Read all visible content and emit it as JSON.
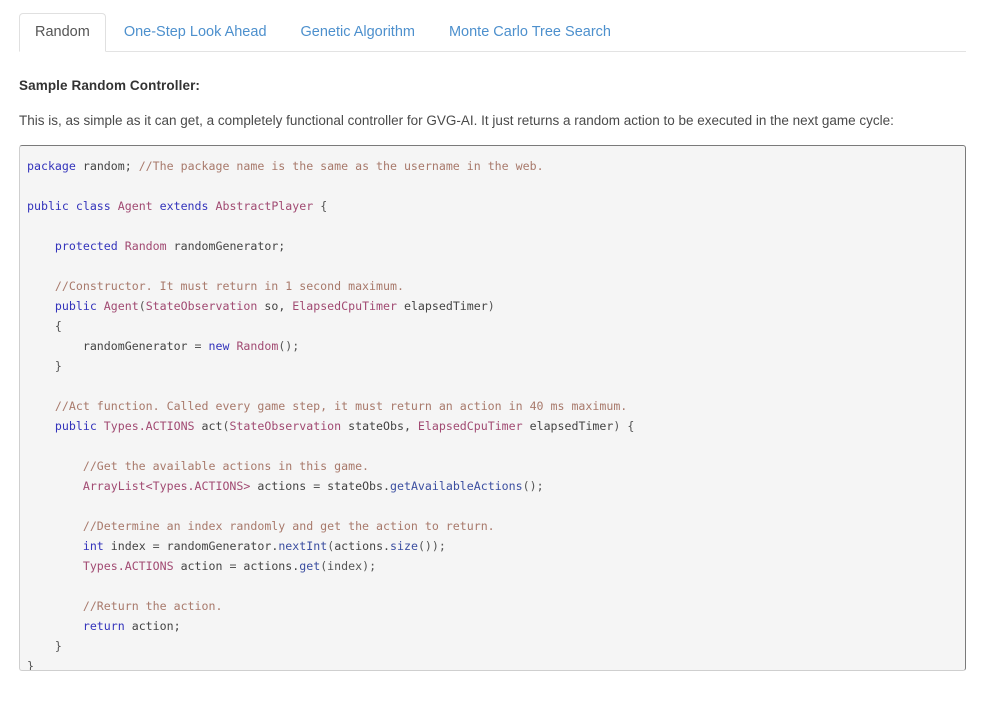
{
  "tabs": [
    {
      "label": "Random",
      "active": true
    },
    {
      "label": "One-Step Look Ahead",
      "active": false
    },
    {
      "label": "Genetic Algorithm",
      "active": false
    },
    {
      "label": "Monte Carlo Tree Search",
      "active": false
    }
  ],
  "main": {
    "heading": "Sample Random Controller:",
    "description": "This is, as simple as it can get, a completely functional controller for GVG-AI. It just returns a random action to be executed in the next game cycle:",
    "code_lines": [
      [
        {
          "t": "k",
          "s": "package"
        },
        {
          "t": "n",
          "s": " random; "
        },
        {
          "t": "c",
          "s": "//The package name is the same as the username in the web."
        }
      ],
      [
        {
          "t": "n",
          "s": ""
        }
      ],
      [
        {
          "t": "k",
          "s": "public class "
        },
        {
          "t": "t",
          "s": "Agent"
        },
        {
          "t": "k",
          "s": " extends "
        },
        {
          "t": "t",
          "s": "AbstractPlayer"
        },
        {
          "t": "p",
          "s": " {"
        }
      ],
      [
        {
          "t": "n",
          "s": ""
        }
      ],
      [
        {
          "t": "n",
          "s": "    "
        },
        {
          "t": "k",
          "s": "protected"
        },
        {
          "t": "n",
          "s": " "
        },
        {
          "t": "t",
          "s": "Random"
        },
        {
          "t": "n",
          "s": " randomGenerator;"
        }
      ],
      [
        {
          "t": "n",
          "s": ""
        }
      ],
      [
        {
          "t": "n",
          "s": "    "
        },
        {
          "t": "c",
          "s": "//Constructor. It must return in 1 second maximum."
        }
      ],
      [
        {
          "t": "n",
          "s": "    "
        },
        {
          "t": "k",
          "s": "public"
        },
        {
          "t": "n",
          "s": " "
        },
        {
          "t": "t",
          "s": "Agent"
        },
        {
          "t": "p",
          "s": "("
        },
        {
          "t": "t",
          "s": "StateObservation"
        },
        {
          "t": "n",
          "s": " so, "
        },
        {
          "t": "t",
          "s": "ElapsedCpuTimer"
        },
        {
          "t": "n",
          "s": " elapsedTimer"
        },
        {
          "t": "p",
          "s": ")"
        }
      ],
      [
        {
          "t": "p",
          "s": "    {"
        }
      ],
      [
        {
          "t": "n",
          "s": "        randomGenerator "
        },
        {
          "t": "p",
          "s": "= "
        },
        {
          "t": "k",
          "s": "new"
        },
        {
          "t": "n",
          "s": " "
        },
        {
          "t": "t",
          "s": "Random"
        },
        {
          "t": "p",
          "s": "();"
        }
      ],
      [
        {
          "t": "p",
          "s": "    }"
        }
      ],
      [
        {
          "t": "n",
          "s": ""
        }
      ],
      [
        {
          "t": "n",
          "s": "    "
        },
        {
          "t": "c",
          "s": "//Act function. Called every game step, it must return an action in 40 ms maximum."
        }
      ],
      [
        {
          "t": "n",
          "s": "    "
        },
        {
          "t": "k",
          "s": "public"
        },
        {
          "t": "n",
          "s": " "
        },
        {
          "t": "t",
          "s": "Types.ACTIONS"
        },
        {
          "t": "n",
          "s": " act"
        },
        {
          "t": "p",
          "s": "("
        },
        {
          "t": "t",
          "s": "StateObservation"
        },
        {
          "t": "n",
          "s": " stateObs, "
        },
        {
          "t": "t",
          "s": "ElapsedCpuTimer"
        },
        {
          "t": "n",
          "s": " elapsedTimer"
        },
        {
          "t": "p",
          "s": ") {"
        }
      ],
      [
        {
          "t": "n",
          "s": ""
        }
      ],
      [
        {
          "t": "n",
          "s": "        "
        },
        {
          "t": "c",
          "s": "//Get the available actions in this game."
        }
      ],
      [
        {
          "t": "n",
          "s": "        "
        },
        {
          "t": "t",
          "s": "ArrayList<Types.ACTIONS>"
        },
        {
          "t": "n",
          "s": " actions "
        },
        {
          "t": "p",
          "s": "= "
        },
        {
          "t": "n",
          "s": "stateObs."
        },
        {
          "t": "f",
          "s": "getAvailableActions"
        },
        {
          "t": "p",
          "s": "();"
        }
      ],
      [
        {
          "t": "n",
          "s": ""
        }
      ],
      [
        {
          "t": "n",
          "s": "        "
        },
        {
          "t": "c",
          "s": "//Determine an index randomly and get the action to return."
        }
      ],
      [
        {
          "t": "n",
          "s": "        "
        },
        {
          "t": "k",
          "s": "int"
        },
        {
          "t": "n",
          "s": " index "
        },
        {
          "t": "p",
          "s": "= "
        },
        {
          "t": "n",
          "s": "randomGenerator."
        },
        {
          "t": "f",
          "s": "nextInt"
        },
        {
          "t": "p",
          "s": "("
        },
        {
          "t": "n",
          "s": "actions."
        },
        {
          "t": "f",
          "s": "size"
        },
        {
          "t": "p",
          "s": "());"
        }
      ],
      [
        {
          "t": "n",
          "s": "        "
        },
        {
          "t": "t",
          "s": "Types.ACTIONS"
        },
        {
          "t": "n",
          "s": " action "
        },
        {
          "t": "p",
          "s": "= "
        },
        {
          "t": "n",
          "s": "actions."
        },
        {
          "t": "f",
          "s": "get"
        },
        {
          "t": "p",
          "s": "(index);"
        }
      ],
      [
        {
          "t": "n",
          "s": ""
        }
      ],
      [
        {
          "t": "n",
          "s": "        "
        },
        {
          "t": "c",
          "s": "//Return the action."
        }
      ],
      [
        {
          "t": "n",
          "s": "        "
        },
        {
          "t": "k",
          "s": "return"
        },
        {
          "t": "n",
          "s": " action;"
        }
      ],
      [
        {
          "t": "p",
          "s": "    }"
        }
      ],
      [
        {
          "t": "p",
          "s": "}"
        }
      ]
    ]
  },
  "colors": {
    "tab_link": "#4d90cd",
    "tab_active_text": "#555555",
    "code_bg": "#f5f5f5",
    "code_border": "#cfcfcf",
    "keyword": "#3333bb",
    "type": "#a14a72",
    "comment": "#a8796b",
    "function": "#3b4ea0"
  }
}
